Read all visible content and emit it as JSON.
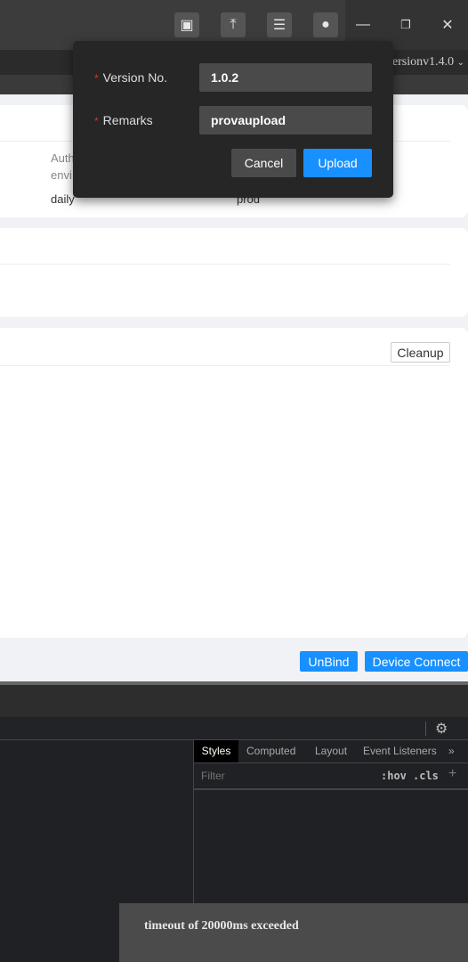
{
  "titlebar": {
    "icons": [
      "screen-code-icon",
      "upload-icon",
      "list-icon",
      "user-icon"
    ],
    "minimize": "—",
    "restore": "❐",
    "close": "✕"
  },
  "version_select": {
    "value": "versionv1.4.0"
  },
  "card1": {
    "col1_header": "Auth",
    "col1_sub": "envi",
    "col1_value": "daily",
    "col2_value": "prod"
  },
  "card3": {
    "cleanup_label": "Cleanup"
  },
  "footer": {
    "unbind_label": "UnBind",
    "device_connect_label": "Device Connect"
  },
  "dialog": {
    "version_label": "Version No.",
    "version_value": "1.0.2",
    "remarks_label": "Remarks",
    "remarks_value": "provaupload",
    "cancel_label": "Cancel",
    "upload_label": "Upload"
  },
  "devtools": {
    "tabs": [
      "Styles",
      "Computed",
      "Layout",
      "Event Listeners"
    ],
    "more": "»",
    "filter_placeholder": "Filter",
    "hov": ":hov",
    "cls": ".cls",
    "add": "+"
  },
  "toast": {
    "message": "timeout of 20000ms exceeded"
  },
  "colors": {
    "primary": "#1890ff",
    "dialog_bg": "#262626",
    "required": "#e03030"
  }
}
